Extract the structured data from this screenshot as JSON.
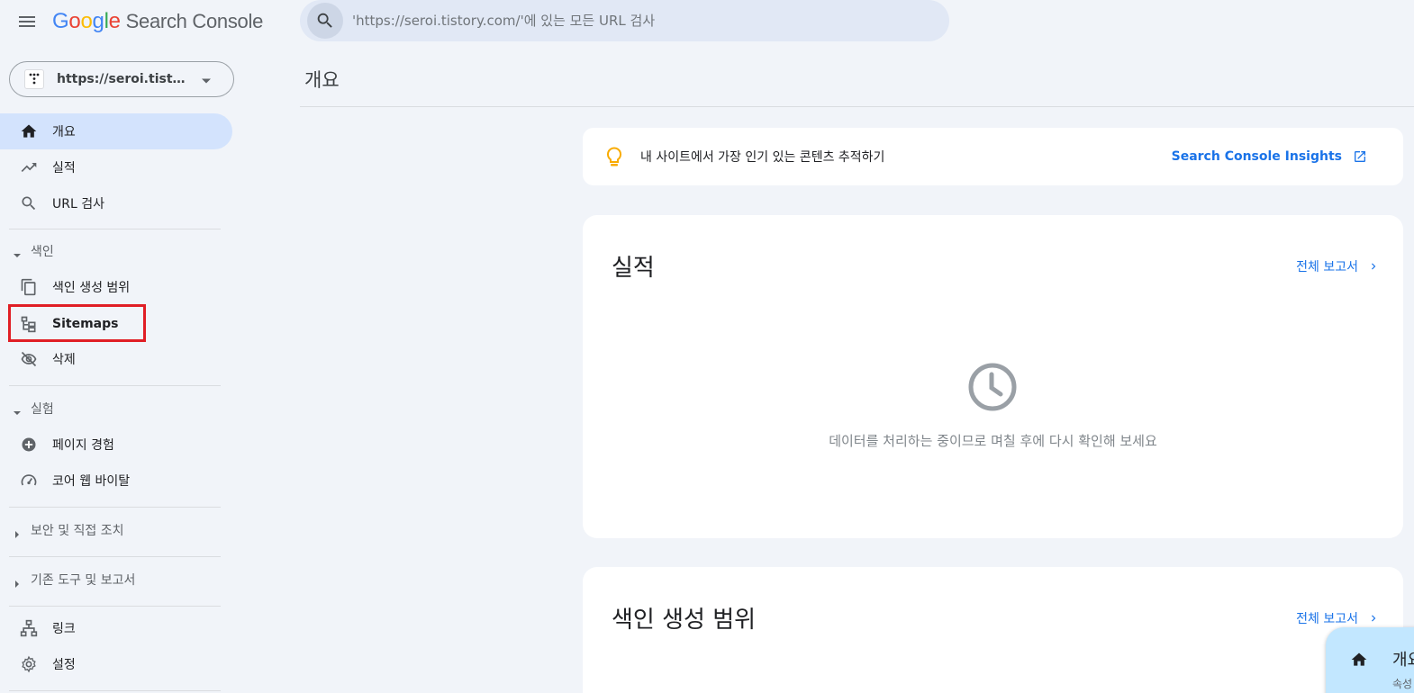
{
  "header": {
    "menu_icon": "hamburger-menu-icon",
    "logo": {
      "google_letters": [
        "G",
        "o",
        "o",
        "g",
        "l",
        "e"
      ],
      "google_colors": [
        "#4285F4",
        "#EA4335",
        "#FBBC05",
        "#4285F4",
        "#34A853",
        "#EA4335"
      ],
      "product": "Search Console"
    },
    "search": {
      "icon": "search-icon",
      "placeholder": "'https://seroi.tistory.com/'에 있는 모든 URL 검사"
    }
  },
  "property_selector": {
    "value": "https://seroi.tistory.com/",
    "icon": "site-favicon",
    "dropdown_icon": "caret-down-icon"
  },
  "sidebar": {
    "items": [
      {
        "label": "개요",
        "icon": "home-icon",
        "active": true
      },
      {
        "label": "실적",
        "icon": "trending-up-icon"
      },
      {
        "label": "URL 검사",
        "icon": "search-icon"
      }
    ],
    "sections": [
      {
        "label": "색인",
        "expanded": true,
        "items": [
          {
            "label": "색인 생성 범위",
            "icon": "file-copy-icon"
          },
          {
            "label": "Sitemaps",
            "icon": "sitemap-icon",
            "highlighted": true
          },
          {
            "label": "삭제",
            "icon": "visibility-off-icon"
          }
        ]
      },
      {
        "label": "실험",
        "expanded": true,
        "items": [
          {
            "label": "페이지 경험",
            "icon": "add-circle-icon"
          },
          {
            "label": "코어 웹 바이탈",
            "icon": "speed-gauge-icon"
          }
        ]
      },
      {
        "label": "보안 및 직접 조치",
        "expanded": false
      },
      {
        "label": "기존 도구 및 보고서",
        "expanded": false
      }
    ],
    "bottom_items": [
      {
        "label": "링크",
        "icon": "links-hierarchy-icon"
      },
      {
        "label": "설정",
        "icon": "settings-gear-icon"
      }
    ],
    "highlight_color": "#e01e25"
  },
  "main": {
    "page_title": "개요",
    "insights": {
      "text": "내 사이트에서 가장 인기 있는 콘텐츠 추적하기",
      "link": "Search Console Insights",
      "icon": "lightbulb-icon",
      "link_icon": "open-in-new-icon"
    },
    "cards": [
      {
        "title": "실적",
        "link": "전체 보고서",
        "status_icon": "clock-icon",
        "message": "데이터를 처리하는 중이므로 며칠 후에 다시 확인해 보세요"
      },
      {
        "title": "색인 생성 범위",
        "link": "전체 보고서"
      }
    ]
  },
  "floating_chip": {
    "title": "개요",
    "subtitle": "속성",
    "icon": "home-icon"
  },
  "colors": {
    "background": "#f1f4f9",
    "accent": "#1a73e8",
    "active_nav": "#d3e3fd",
    "search_bg": "#e1e8f5",
    "bulb": "#f9ab00"
  }
}
